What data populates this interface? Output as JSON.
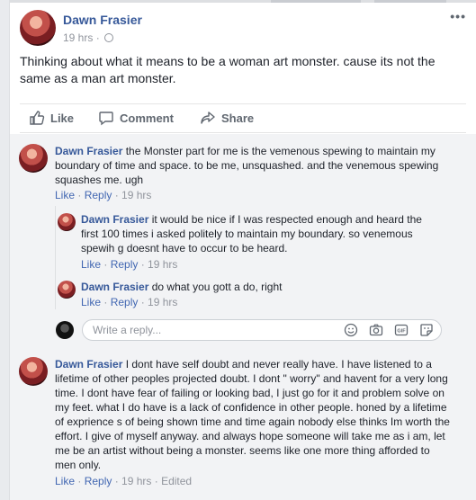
{
  "post": {
    "author": "Dawn Frasier",
    "time": "19 hrs",
    "separator": "·",
    "more": "•••",
    "text": "Thinking about what it means to be a woman art monster. cause its not the same as a man art monster."
  },
  "actions": {
    "like": "Like",
    "comment": "Comment",
    "share": "Share"
  },
  "comments": [
    {
      "author": "Dawn Frasier",
      "text": "the Monster part for me is the vemenous spewing to maintain my boundary of time and space. to be me, unsquashed. and the venemous spewing squashes me. ugh",
      "like": "Like",
      "reply": "Reply",
      "time": "19 hrs"
    },
    {
      "author": "Dawn Frasier",
      "text": "it would be nice if I was respected enough and heard the first 100 times i asked politely to maintain my boundary. so venemous spewih g doesnt have to occur to be heard.",
      "like": "Like",
      "reply": "Reply",
      "time": "19 hrs"
    },
    {
      "author": "Dawn Frasier",
      "text": "do what you gott a do, right",
      "like": "Like",
      "reply": "Reply",
      "time": "19 hrs"
    },
    {
      "author": "Dawn Frasier",
      "text": "I dont have self doubt and never really have. I have listened to a lifetime of other peoples projected doubt. I dont \" worry\" and havent for a very long time. I dont have fear of failing or looking bad, I just go for it and problem solve on my feet. what I do have is a lack of confidence in other people. honed by a lifetime of exprience s of being shown time and time again nobody else thinks Im worth the effort. I give of myself anyway. and always hope someone will take me as i am, let me be an artist without being a monster. seems like one more thing afforded to men only.",
      "like": "Like",
      "reply": "Reply",
      "time": "19 hrs",
      "edited": "Edited"
    }
  ],
  "reply_box": {
    "placeholder": "Write a reply..."
  },
  "icons": [
    "globe-icon",
    "like-icon",
    "comment-icon",
    "share-icon",
    "emoji-icon",
    "camera-icon",
    "gif-icon",
    "sticker-icon"
  ]
}
